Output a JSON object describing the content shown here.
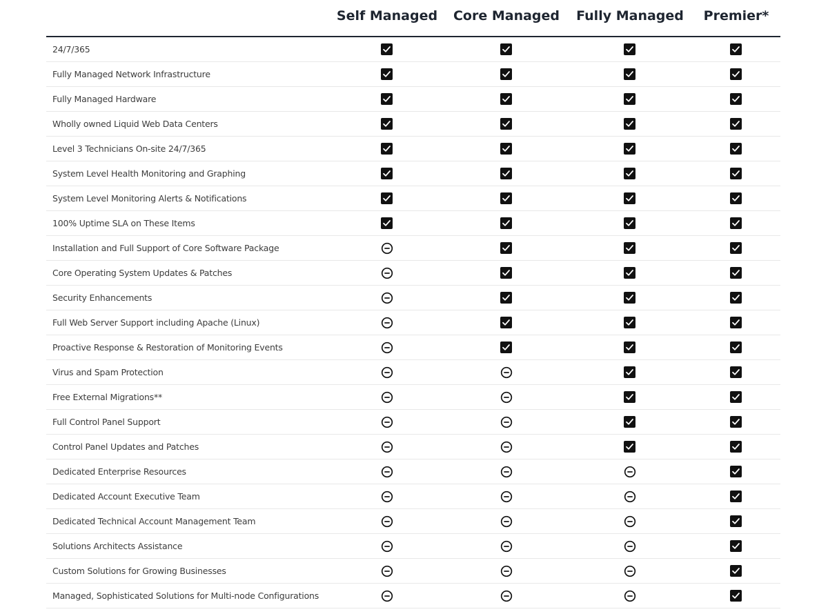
{
  "columns": [
    "Self Managed",
    "Core Managed",
    "Fully Managed",
    "Premier*"
  ],
  "icons": {
    "yes": "checkbox-checked-icon",
    "no": "minus-circle-icon"
  },
  "rows": [
    {
      "label": "24/7/365",
      "values": [
        true,
        true,
        true,
        true
      ]
    },
    {
      "label": "Fully Managed Network Infrastructure",
      "values": [
        true,
        true,
        true,
        true
      ]
    },
    {
      "label": "Fully Managed Hardware",
      "values": [
        true,
        true,
        true,
        true
      ]
    },
    {
      "label": "Wholly owned Liquid Web Data Centers",
      "values": [
        true,
        true,
        true,
        true
      ]
    },
    {
      "label": "Level 3 Technicians On-site 24/7/365",
      "values": [
        true,
        true,
        true,
        true
      ]
    },
    {
      "label": "System Level Health Monitoring and Graphing",
      "values": [
        true,
        true,
        true,
        true
      ]
    },
    {
      "label": "System Level Monitoring Alerts & Notifications",
      "values": [
        true,
        true,
        true,
        true
      ]
    },
    {
      "label": "100% Uptime SLA on These Items",
      "values": [
        true,
        true,
        true,
        true
      ]
    },
    {
      "label": "Installation and Full Support of Core Software Package",
      "values": [
        false,
        true,
        true,
        true
      ]
    },
    {
      "label": "Core Operating System Updates & Patches",
      "values": [
        false,
        true,
        true,
        true
      ]
    },
    {
      "label": "Security Enhancements",
      "values": [
        false,
        true,
        true,
        true
      ]
    },
    {
      "label": "Full Web Server Support including Apache (Linux)",
      "values": [
        false,
        true,
        true,
        true
      ]
    },
    {
      "label": "Proactive Response & Restoration of Monitoring Events",
      "values": [
        false,
        true,
        true,
        true
      ]
    },
    {
      "label": "Virus and Spam Protection",
      "values": [
        false,
        false,
        true,
        true
      ]
    },
    {
      "label": "Free External Migrations**",
      "values": [
        false,
        false,
        true,
        true
      ]
    },
    {
      "label": "Full Control Panel Support",
      "values": [
        false,
        false,
        true,
        true
      ]
    },
    {
      "label": "Control Panel Updates and Patches",
      "values": [
        false,
        false,
        true,
        true
      ]
    },
    {
      "label": "Dedicated Enterprise Resources",
      "values": [
        false,
        false,
        false,
        true
      ]
    },
    {
      "label": "Dedicated Account Executive Team",
      "values": [
        false,
        false,
        false,
        true
      ]
    },
    {
      "label": "Dedicated Technical Account Management Team",
      "values": [
        false,
        false,
        false,
        true
      ]
    },
    {
      "label": "Solutions Architects Assistance",
      "values": [
        false,
        false,
        false,
        true
      ]
    },
    {
      "label": "Custom Solutions for Growing Businesses",
      "values": [
        false,
        false,
        false,
        true
      ]
    },
    {
      "label": "Managed, Sophisticated Solutions for Multi-node Configurations",
      "values": [
        false,
        false,
        false,
        true
      ]
    }
  ]
}
